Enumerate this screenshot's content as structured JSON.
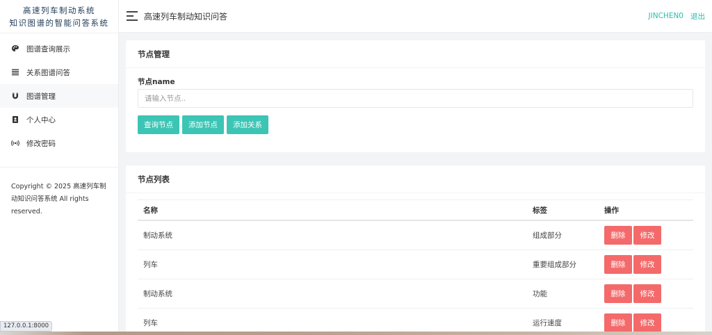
{
  "sidebar": {
    "brand_line1": "高速列车制动系统",
    "brand_line2": "知识图谱的智能问答系统",
    "items": [
      {
        "label": "图谱查询展示",
        "icon": "palette-icon"
      },
      {
        "label": "关系图谱问答",
        "icon": "list-icon"
      },
      {
        "label": "图谱管理",
        "icon": "magnet-icon"
      },
      {
        "label": "个人中心",
        "icon": "address-book-icon"
      },
      {
        "label": "修改密码",
        "icon": "broadcast-icon"
      }
    ],
    "active_index": 2,
    "copyright": "Copyright © 2025 高速列车制动知识问答系统 All rights reserved."
  },
  "header": {
    "title": "高速列车制动知识问答",
    "username": "JINCHEN0",
    "logout": "退出"
  },
  "node_management": {
    "title": "节点管理",
    "field_label": "节点name",
    "input_value": "",
    "input_placeholder": "请输入节点..",
    "buttons": {
      "query": "查询节点",
      "add_node": "添加节点",
      "add_relation": "添加关系"
    }
  },
  "node_list": {
    "title": "节点列表",
    "columns": {
      "name": "名称",
      "label": "标签",
      "ops": "操作"
    },
    "delete_label": "删除",
    "edit_label": "修改",
    "rows": [
      {
        "name": "制动系统",
        "label": "组成部分"
      },
      {
        "name": "列车",
        "label": "重要组成部分"
      },
      {
        "name": "制动系统",
        "label": "功能"
      },
      {
        "name": "列车",
        "label": "运行速度"
      }
    ]
  },
  "statusbar": {
    "url": "127.0.0.1:8000"
  },
  "colors": {
    "accent_teal": "#3cc5b5",
    "danger_red": "#f46a6a",
    "link_teal": "#2bbcac"
  }
}
